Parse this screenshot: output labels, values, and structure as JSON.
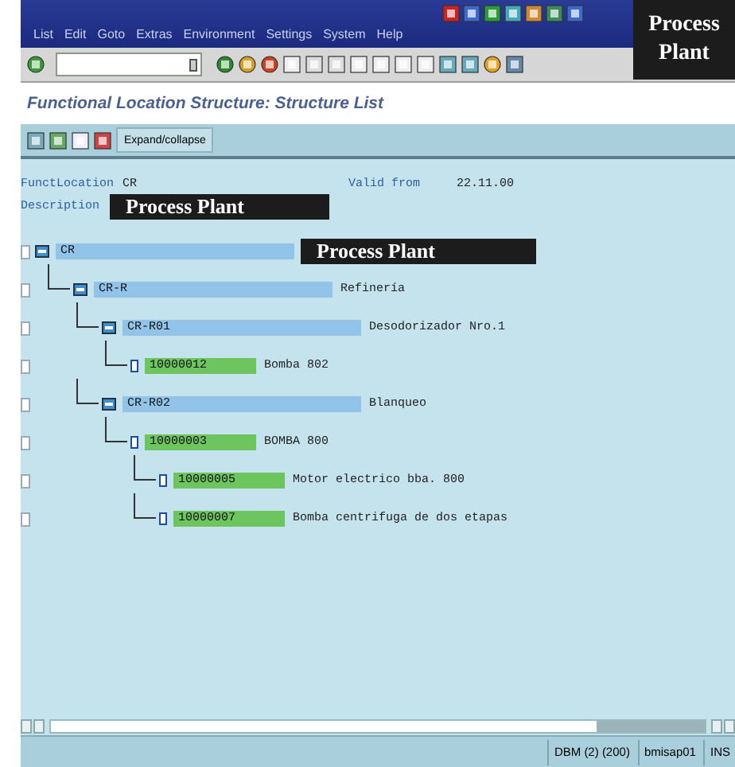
{
  "menu_bar": {
    "items": [
      "List",
      "Edit",
      "Goto",
      "Extras",
      "Environment",
      "Settings",
      "System",
      "Help"
    ]
  },
  "corner_label": "Process Plant",
  "screen_title": "Functional Location Structure: Structure List",
  "app_toolbar": {
    "button": "Expand/collapse"
  },
  "header": {
    "functlocation_label": "FunctLocation",
    "functlocation": "CR",
    "valid_from_label": "Valid from",
    "valid_from": "22.11.00",
    "description_label": "Description",
    "description": "Process Plant"
  },
  "tree": [
    {
      "kind": "location",
      "id": "CR",
      "description": "Process Plant",
      "boxed": true,
      "checked": false,
      "children": [
        {
          "kind": "location",
          "id": "CR-R",
          "description": "Refinería",
          "boxed": false,
          "checked": false,
          "children": [
            {
              "kind": "location",
              "id": "CR-R01",
              "description": "Desodorizador Nro.1",
              "boxed": false,
              "checked": false,
              "children": [
                {
                  "kind": "equipment",
                  "id": "10000012",
                  "description": "Bomba 802",
                  "boxed": false,
                  "checked": false
                }
              ]
            },
            {
              "kind": "location",
              "id": "CR-R02",
              "description": "Blanqueo",
              "boxed": false,
              "checked": false,
              "children": [
                {
                  "kind": "equipment",
                  "id": "10000003",
                  "description": "BOMBA 800",
                  "boxed": false,
                  "checked": false,
                  "children": [
                    {
                      "kind": "equipment",
                      "id": "10000005",
                      "description": "Motor electrico bba. 800",
                      "boxed": false,
                      "checked": false
                    },
                    {
                      "kind": "equipment",
                      "id": "10000007",
                      "description": "Bomba centrifuga de dos etapas",
                      "boxed": false,
                      "checked": false
                    }
                  ]
                }
              ]
            }
          ]
        }
      ]
    }
  ],
  "status_bar": {
    "items": [
      "DBM (2) (200)",
      "bmisap01",
      "INS"
    ]
  }
}
